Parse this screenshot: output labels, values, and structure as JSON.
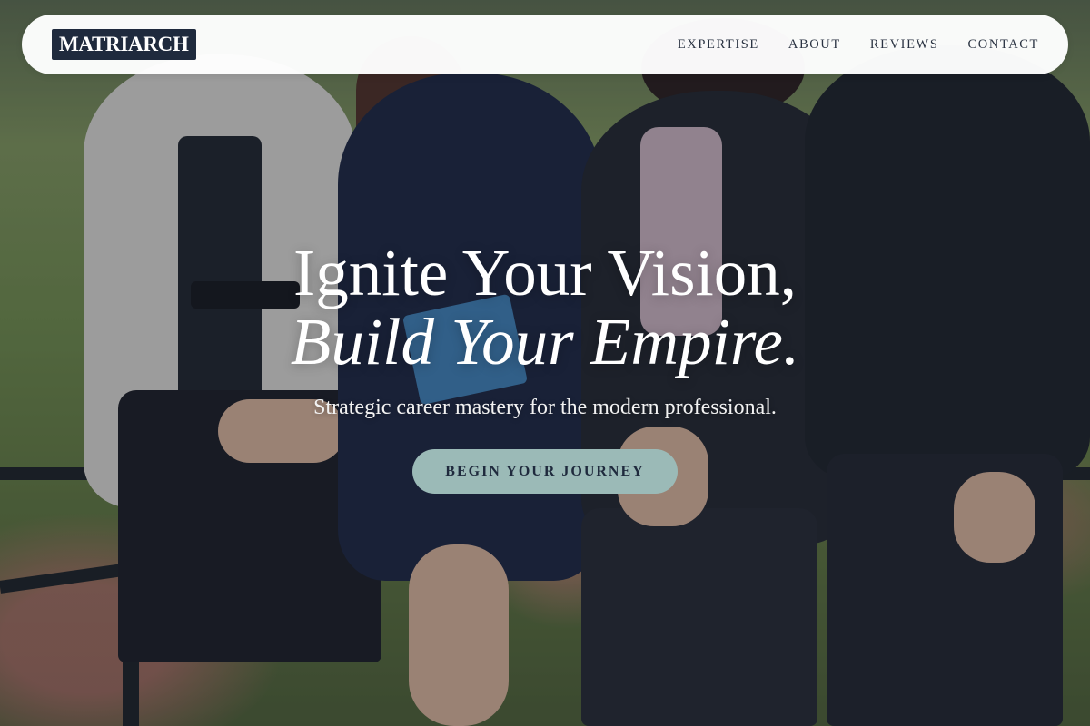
{
  "brand": {
    "logo_text": "MATRIARCH"
  },
  "nav": {
    "items": [
      {
        "label": "EXPERTISE"
      },
      {
        "label": "ABOUT"
      },
      {
        "label": "REVIEWS"
      },
      {
        "label": "CONTACT"
      }
    ]
  },
  "hero": {
    "title_line1": "Ignite Your Vision,",
    "title_line2": "Build Your Empire.",
    "subtitle": "Strategic career mastery for the modern professional.",
    "cta_label": "BEGIN YOUR JOURNEY",
    "background_image": "four-professional-women-in-suits"
  },
  "colors": {
    "brand_navy": "#1f2a3d",
    "cta_teal": "#9bbab7",
    "nav_bg": "#ffffff",
    "hero_text": "#ffffff"
  }
}
